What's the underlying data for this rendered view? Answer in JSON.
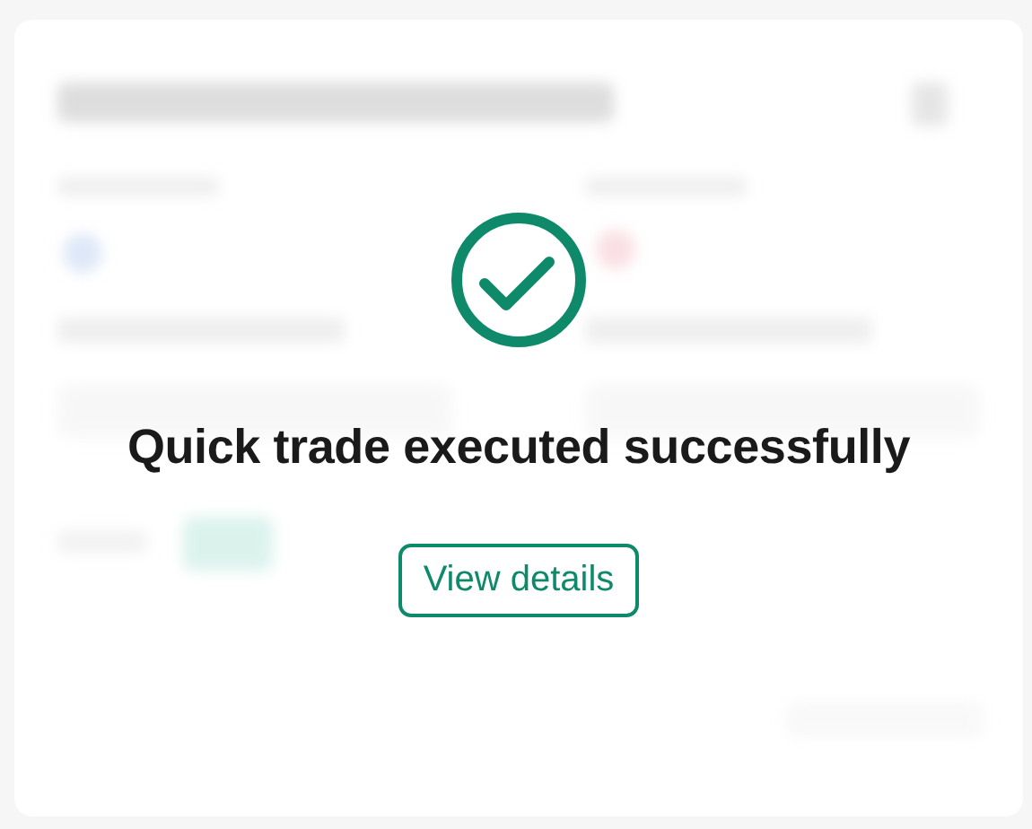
{
  "dialog": {
    "kind": "success",
    "message": "Quick trade executed successfully",
    "button": "View details"
  }
}
